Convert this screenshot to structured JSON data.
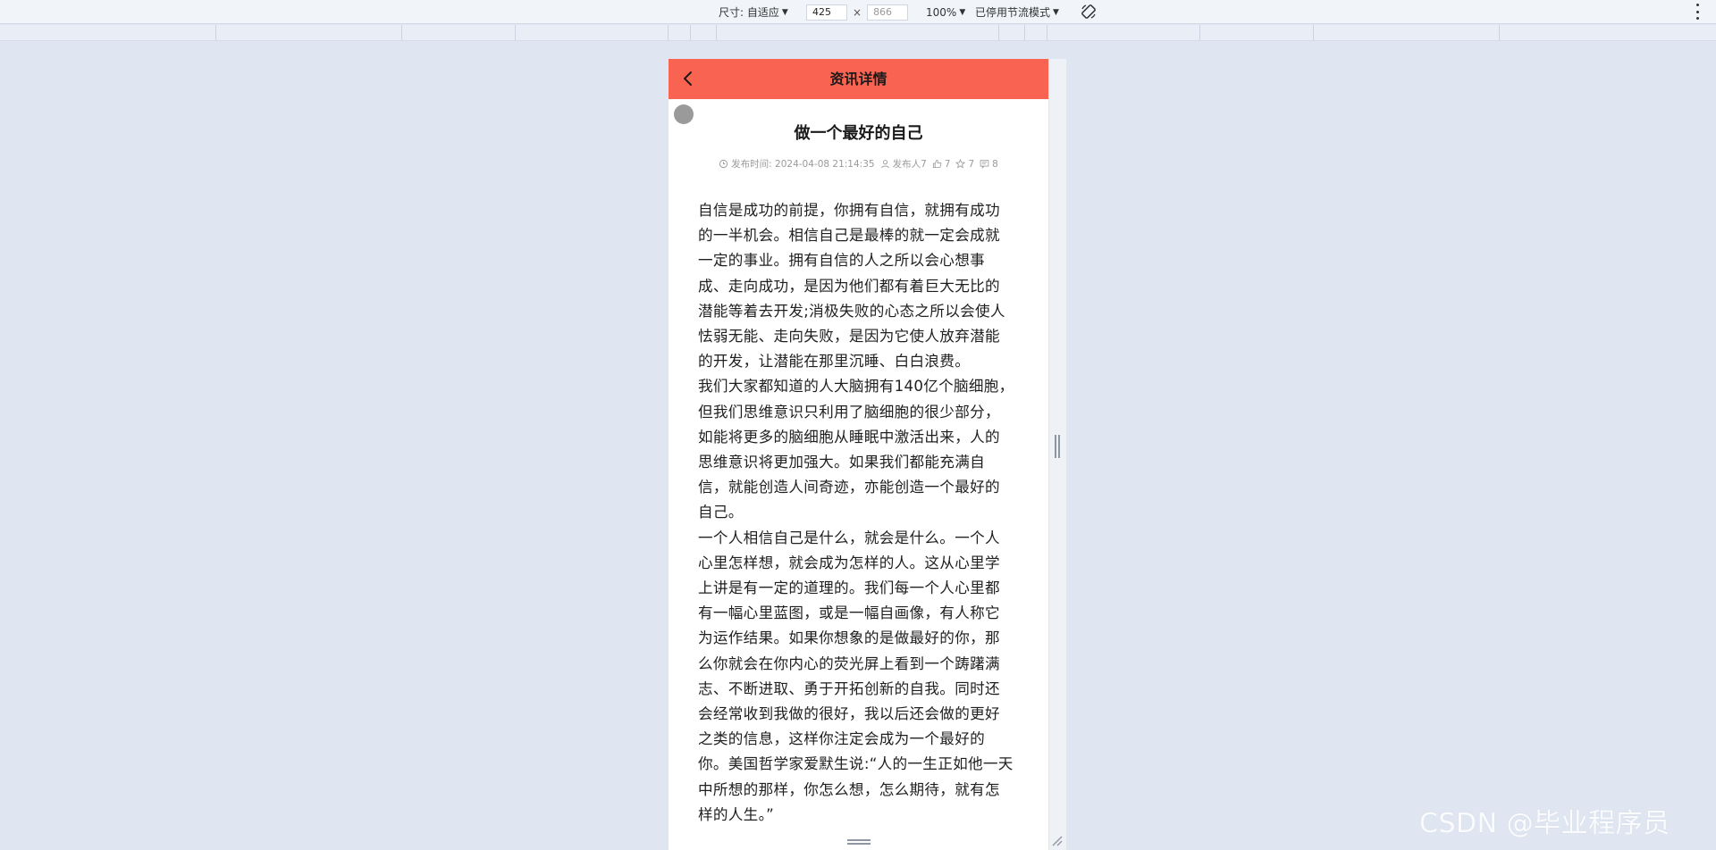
{
  "devtools": {
    "size_label": "尺寸: 自适应",
    "width_value": "425",
    "height_placeholder": "866",
    "times": "×",
    "zoom": "100%",
    "throttle": "已停用节流模式"
  },
  "app": {
    "header_title": "资讯详情",
    "article_title": "做一个最好的自己",
    "meta": {
      "time_label": "发布时间: 2024-04-08 21:14:35",
      "publisher_label": "发布人7",
      "like_count": "7",
      "fav_count": "7",
      "comment_count": "8"
    },
    "paragraphs": [
      "自信是成功的前提，你拥有自信，就拥有成功的一半机会。相信自己是最棒的就一定会成就一定的事业。拥有自信的人之所以会心想事成、走向成功，是因为他们都有着巨大无比的潜能等着去开发;消极失败的心态之所以会使人怯弱无能、走向失败，是因为它使人放弃潜能的开发，让潜能在那里沉睡、白白浪费。",
      "我们大家都知道的人大脑拥有140亿个脑细胞，但我们思维意识只利用了脑细胞的很少部分，如能将更多的脑细胞从睡眠中激活出来，人的思维意识将更加强大。如果我们都能充满自信，就能创造人间奇迹，亦能创造一个最好的自己。",
      "一个人相信自己是什么，就会是什么。一个人心里怎样想，就会成为怎样的人。这从心里学上讲是有一定的道理的。我们每一个人心里都有一幅心里蓝图，或是一幅自画像，有人称它为运作结果。如果你想象的是做最好的你，那么你就会在你内心的荧光屏上看到一个踌躇满志、不断进取、勇于开拓创新的自我。同时还会经常收到我做的很好，我以后还会做的更好之类的信息，这样你注定会成为一个最好的你。美国哲学家爱默生说:“人的一生正如他一天中所想的那样，你怎么想，怎么期待，就有怎样的人生。”"
    ]
  },
  "watermark": "CSDN @毕业程序员",
  "colors": {
    "header_bg": "#f96351",
    "page_bg": "#dfe6f2"
  }
}
